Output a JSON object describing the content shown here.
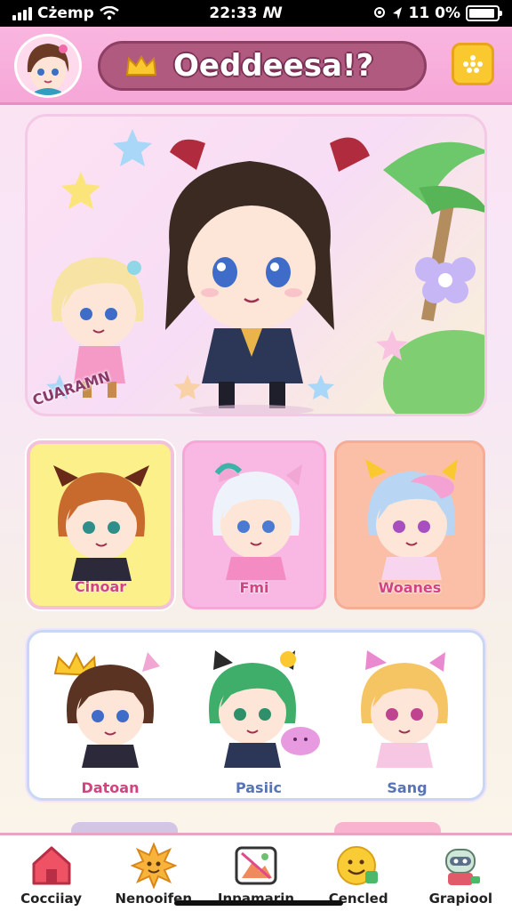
{
  "status": {
    "carrier": "Cżemp",
    "time": "22:33 ꟿ",
    "battery": "11 0%"
  },
  "header": {
    "title": "Oeddeesa!?"
  },
  "hero": {
    "label": "CUARAMN"
  },
  "cards": [
    {
      "label": "Cinoar"
    },
    {
      "label": "Fmi"
    },
    {
      "label": "Woanes"
    }
  ],
  "row": [
    {
      "label": "Datoan"
    },
    {
      "label": "Pasiic"
    },
    {
      "label": "Sang"
    }
  ],
  "nav": [
    {
      "label": "Cocciiay",
      "icon": "home-icon"
    },
    {
      "label": "Nenooifen",
      "icon": "sun-icon"
    },
    {
      "label": "Inpamarin",
      "icon": "gallery-icon"
    },
    {
      "label": "Cencled",
      "icon": "smiley-icon"
    },
    {
      "label": "Grapiool",
      "icon": "robot-icon"
    }
  ],
  "colors": {
    "accent_pink": "#f6a7d8",
    "title_pill": "#b05a80",
    "menu_yellow": "#f9c92f",
    "label_pink": "#d2437f"
  }
}
